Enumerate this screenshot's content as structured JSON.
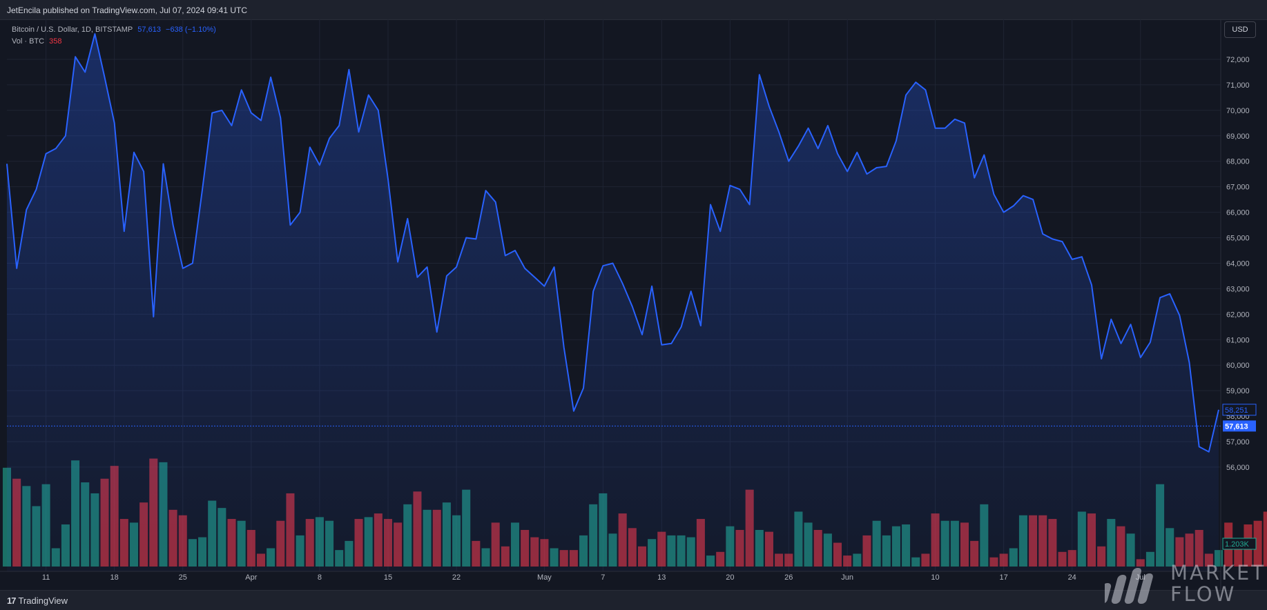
{
  "header": {
    "published_text": "JetEncila published on TradingView.com, Jul 07, 2024 09:41 UTC"
  },
  "legend": {
    "symbol": "Bitcoin / U.S. Dollar, 1D, BITSTAMP",
    "last": "57,613",
    "change": "−638 (−1.10%)",
    "vol_label": "Vol · BTC",
    "vol_value": "358"
  },
  "currency_button": "USD",
  "footer": {
    "brand": "TradingView",
    "brand_icon": "tradingview-logo-icon"
  },
  "watermark": {
    "line1": "MARKET",
    "line2": "FLOW"
  },
  "colors": {
    "line": "#2962ff",
    "up_volume": "#22ab94",
    "down_volume": "#f23645",
    "background": "#131722"
  },
  "chart_data": {
    "type": "area",
    "symbol": "BTCUSD",
    "interval": "1D",
    "y_axis": {
      "ticks": [
        56000,
        57000,
        58000,
        59000,
        60000,
        61000,
        62000,
        63000,
        64000,
        65000,
        66000,
        67000,
        68000,
        69000,
        70000,
        71000,
        72000
      ],
      "ylim": [
        53900,
        73100
      ],
      "position": "right"
    },
    "x_ticks": [
      "11",
      "18",
      "25",
      "Apr",
      "8",
      "15",
      "22",
      "May",
      "7",
      "13",
      "20",
      "26",
      "Jun",
      "10",
      "17",
      "24",
      "Jul"
    ],
    "price_labels": {
      "current": "58,251",
      "previous_close": "57,613",
      "volume": "1.203K"
    },
    "grid": true,
    "series": [
      {
        "values": [
          67900,
          63800,
          66100,
          66900,
          68300,
          68500,
          69000,
          72100,
          71500,
          73000,
          71300,
          69500,
          65250,
          68350,
          67600,
          61900,
          67900,
          65500,
          63800,
          64000,
          66900,
          69900,
          70000,
          69400,
          70800,
          69900,
          69600,
          71300,
          69700,
          65500,
          66000,
          68550,
          67850,
          68900,
          69400,
          71600,
          69150,
          70600,
          70000,
          67300,
          64050,
          65750,
          63450,
          63850,
          61300,
          63500,
          63850,
          65000,
          64950,
          66850,
          66400,
          64300,
          64500,
          63800,
          63450,
          63100,
          63850,
          60700,
          58200,
          59100,
          62900,
          63900,
          64000,
          63200,
          62300,
          61200,
          63100,
          60800,
          60850,
          61500,
          62900,
          61550,
          66300,
          65250,
          67050,
          66900,
          66300,
          71400,
          70150,
          69150,
          68000,
          68600,
          69300,
          68500,
          69400,
          68300,
          67600,
          68350,
          67500,
          67750,
          67800,
          68800,
          70600,
          71100,
          70800,
          69300,
          69300,
          69650,
          69500,
          67350,
          68250,
          66700,
          66000,
          66250,
          66650,
          66500,
          65150,
          64950,
          64850,
          64150,
          64250,
          63150,
          60250,
          61800,
          60850,
          61600,
          60300,
          60900,
          62650,
          62800,
          61950,
          60100,
          56800,
          56600,
          58251
        ]
      }
    ],
    "volume": {
      "label": "Vol · BTC",
      "values": [
        2700,
        2400,
        2200,
        1650,
        2250,
        500,
        1150,
        2900,
        2300,
        2000,
        2400,
        2750,
        1300,
        1200,
        1750,
        2950,
        2850,
        1550,
        1400,
        750,
        800,
        1800,
        1600,
        1300,
        1250,
        1000,
        350,
        500,
        1250,
        2000,
        850,
        1300,
        1350,
        1250,
        450,
        700,
        1300,
        1350,
        1450,
        1300,
        1200,
        1700,
        2050,
        1550,
        1550,
        1750,
        1400,
        2100,
        700,
        500,
        1200,
        550,
        1200,
        1000,
        800,
        750,
        500,
        450,
        450,
        850,
        1700,
        2000,
        900,
        1450,
        1050,
        550,
        750,
        950,
        850,
        850,
        800,
        1300,
        300,
        400,
        1100,
        1000,
        2100,
        1000,
        950,
        350,
        350,
        1500,
        1200,
        1000,
        900,
        650,
        300,
        350,
        850,
        1250,
        850,
        1100,
        1150,
        250,
        350,
        1450,
        1250,
        1250,
        1200,
        700,
        1700,
        250,
        350,
        500,
        1400,
        1400,
        1400,
        1300,
        400,
        450,
        1500,
        1450,
        550,
        1300,
        1100,
        900,
        200,
        400,
        2250,
        1050,
        800,
        900,
        1000,
        350,
        450,
        1200,
        650,
        1150,
        1250,
        1500,
        500
      ],
      "up": [
        true,
        false,
        true,
        true,
        true,
        true,
        true,
        true,
        true,
        true,
        false,
        false,
        false,
        true,
        false,
        false,
        true,
        false,
        false,
        true,
        true,
        true,
        true,
        false,
        true,
        false,
        false,
        true,
        false,
        false,
        true,
        false,
        true,
        true,
        true,
        true,
        false,
        true,
        false,
        false,
        false,
        true,
        false,
        true,
        false,
        true,
        true,
        true,
        false,
        true,
        false,
        false,
        true,
        false,
        false,
        false,
        true,
        false,
        false,
        true,
        true,
        true,
        true,
        false,
        false,
        false,
        true,
        false,
        true,
        true,
        true,
        false,
        true,
        false,
        true,
        false,
        false,
        true,
        false,
        false,
        false,
        true,
        true,
        false,
        true,
        false,
        false,
        true,
        false,
        true,
        true,
        true,
        true,
        true,
        false,
        false,
        true,
        true,
        false,
        false,
        true,
        false,
        false,
        true,
        true,
        false,
        false,
        false,
        false,
        false,
        true,
        false,
        false,
        true,
        false,
        true,
        false,
        true,
        true,
        true,
        false,
        false,
        false,
        false,
        true
      ]
    }
  }
}
